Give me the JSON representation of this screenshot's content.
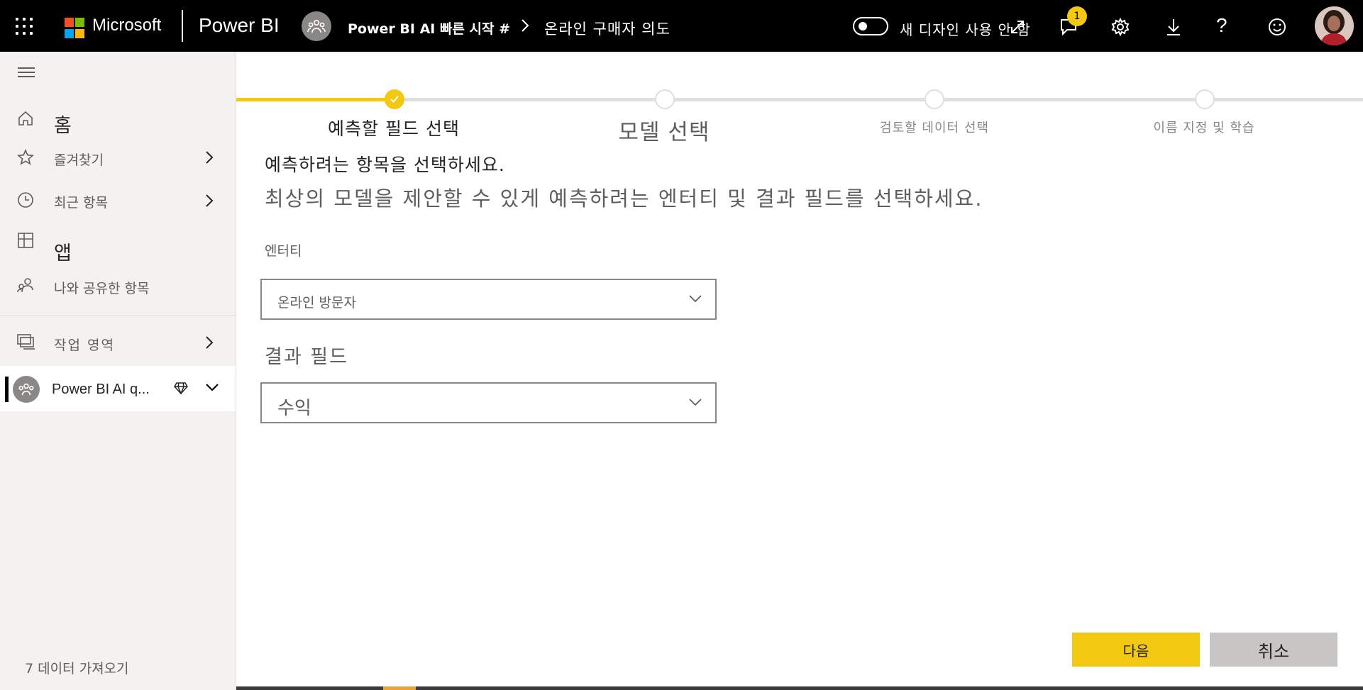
{
  "header": {
    "brand": "Microsoft",
    "product": "Power BI",
    "breadcrumb_workspace": "Power BI AI 빠른 시작 #",
    "breadcrumb_page": "온라인 구매자 의도",
    "toggle_label": "새 디자인 사용 안 함",
    "notification_count": "1",
    "help_glyph": "?",
    "icons": [
      "waffle-icon",
      "workspace-icon",
      "chevron-right-icon",
      "expand-icon",
      "notification-icon",
      "gear-icon",
      "download-icon",
      "help-icon",
      "smiley-icon",
      "user-avatar"
    ]
  },
  "colors": {
    "topbar": "#000000",
    "accent": "#f2c811",
    "sidebar_bg": "#f3f2f1",
    "cancel_bg": "#c8c6c4",
    "ms_red": "#f25022",
    "ms_green": "#7fba00",
    "ms_blue": "#00a4ef",
    "ms_yellow": "#ffb900"
  },
  "sidebar": {
    "items": [
      {
        "label": "홈",
        "icon": "home-icon"
      },
      {
        "label": "즐겨찾기",
        "icon": "star-icon"
      },
      {
        "label": "최근 항목",
        "icon": "clock-icon"
      },
      {
        "label": "앱",
        "icon": "apps-icon"
      },
      {
        "label": "나와 공유한 항목",
        "icon": "shared-icon"
      },
      {
        "label": "작업 영역",
        "icon": "workspaces-icon"
      }
    ],
    "active_workspace": "Power BI AI q...",
    "get_data": "7 데이터 가져오기"
  },
  "wizard": {
    "steps": [
      {
        "label": "예측할 필드 선택",
        "state": "done"
      },
      {
        "label": "모델 선택",
        "state": "upcoming"
      },
      {
        "label": "검토할 데이터 선택",
        "state": "upcoming"
      },
      {
        "label": "이름 지정 및 학습",
        "state": "upcoming"
      }
    ],
    "heading": "예측하려는 항목을 선택하세요.",
    "subheading": "최상의 모델을 제안할 수 있게 예측하려는 엔터티 및 결과 필드를 선택하세요.",
    "entity_label": "엔터티",
    "entity_value": "온라인 방문자",
    "outcome_label": "결과 필드",
    "outcome_value": "수익",
    "next_label": "다음",
    "cancel_label": "취소"
  }
}
